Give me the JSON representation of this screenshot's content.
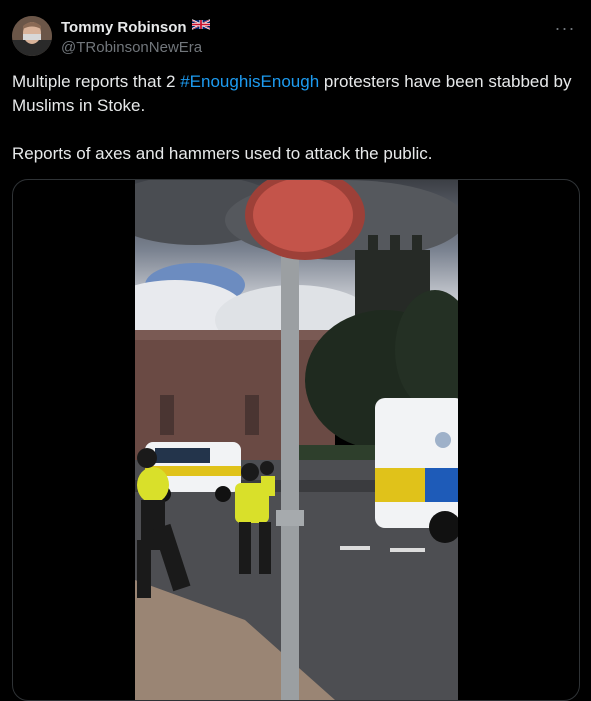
{
  "author": {
    "display_name": "Tommy Robinson",
    "flag": "🇬🇧",
    "handle": "@TRobinsonNewEra"
  },
  "more_label": "···",
  "tweet": {
    "line1_prefix": "Multiple reports that 2 ",
    "hashtag": "#EnoughisEnough",
    "line1_suffix": " protesters have been stabbed by Muslims in Stoke.",
    "line2": "Reports of axes and hammers used to attack the public."
  },
  "colors": {
    "background": "#000000",
    "text": "#e7e9ea",
    "secondary": "#71767b",
    "link": "#1d9bf0",
    "border": "#2f3336"
  },
  "icons": [
    "more-icon",
    "uk-flag-icon"
  ]
}
